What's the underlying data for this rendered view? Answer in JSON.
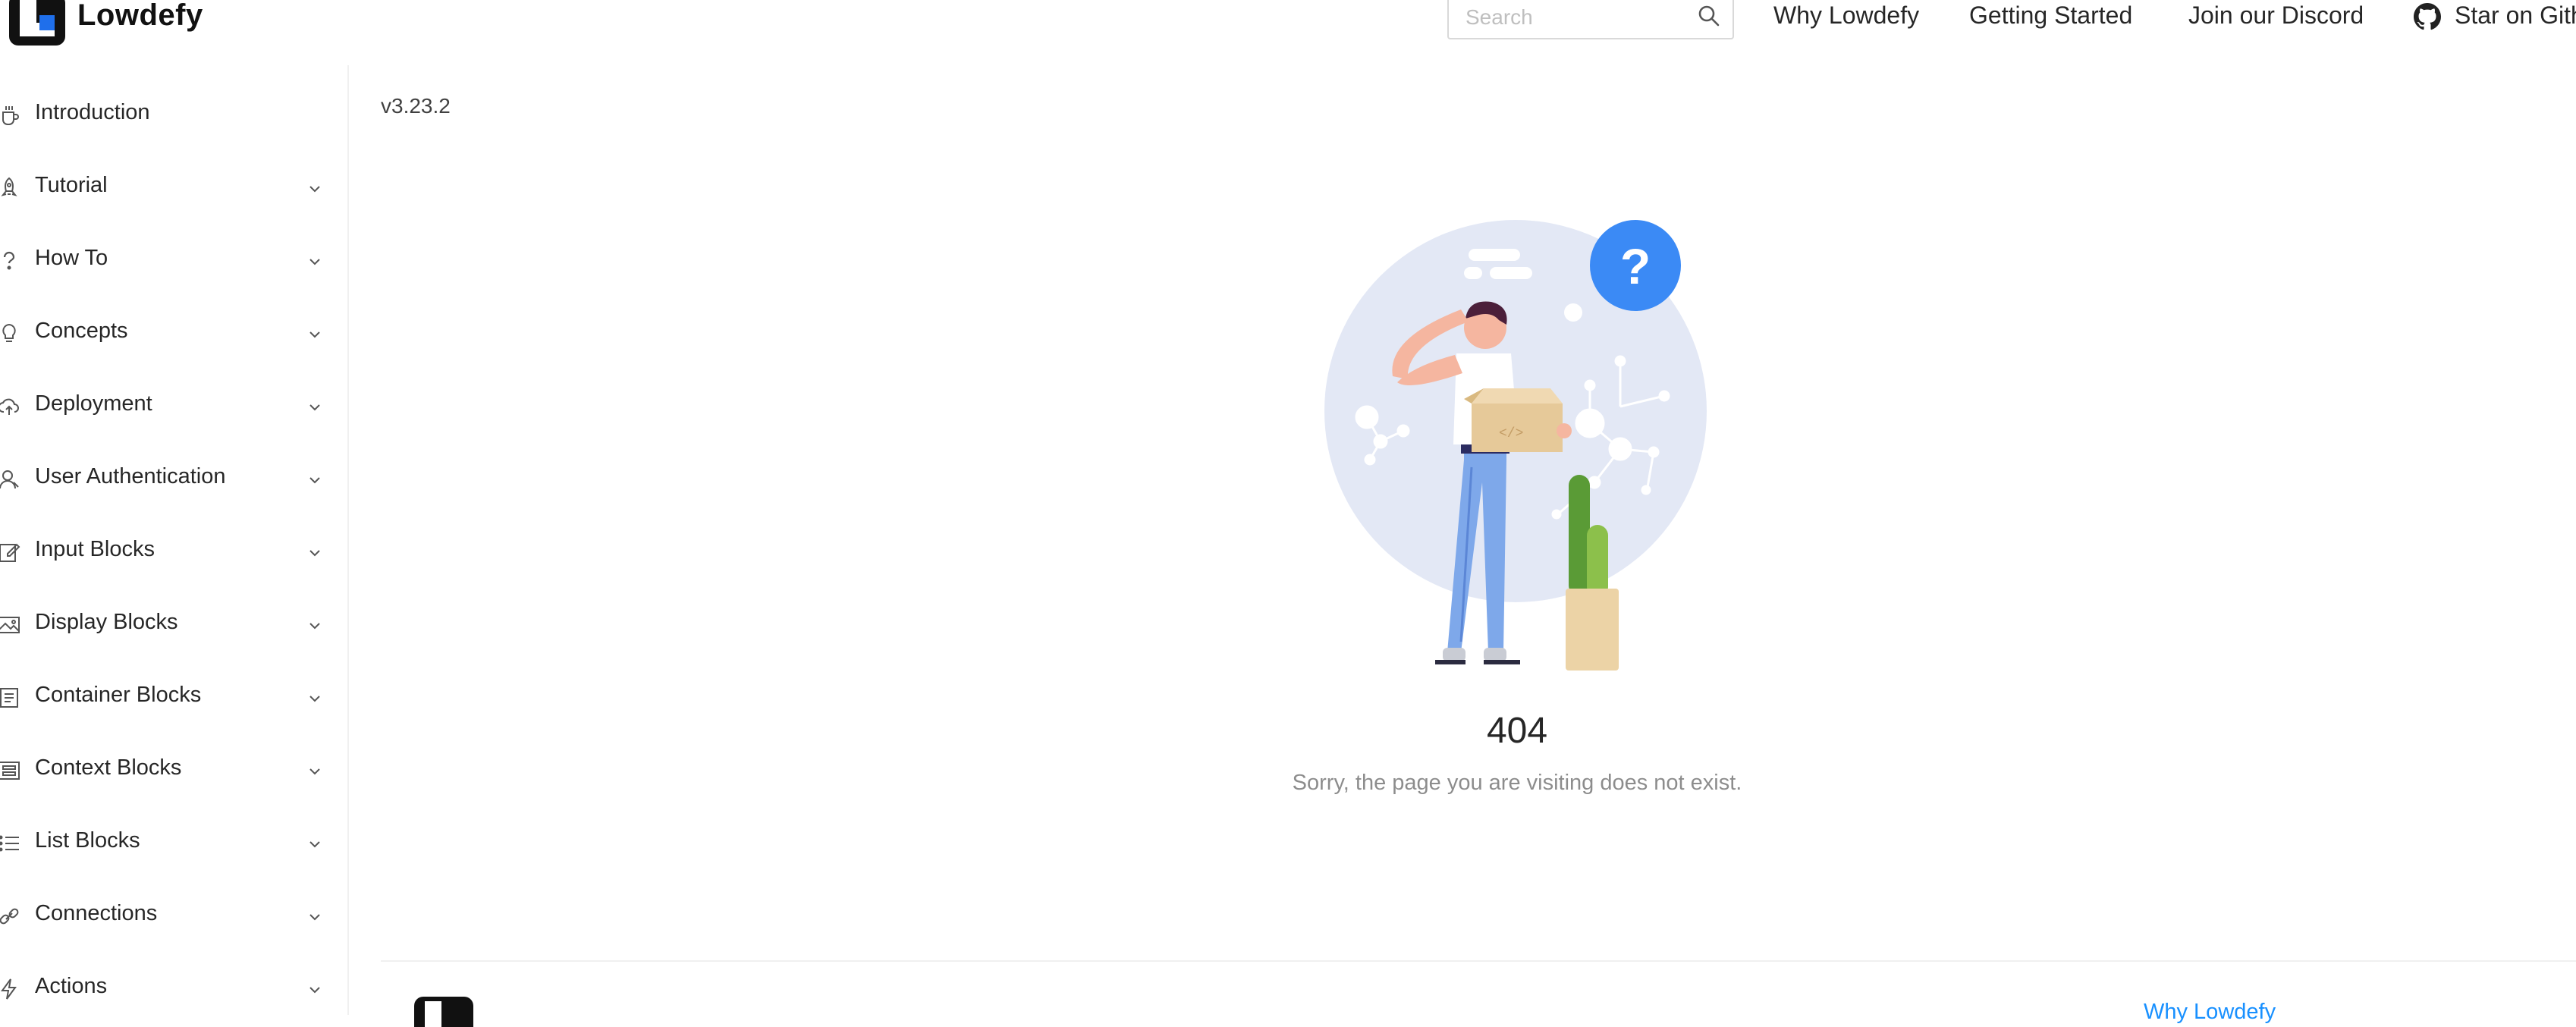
{
  "header": {
    "brand": "Lowdefy",
    "search": {
      "placeholder": "Search"
    },
    "nav": [
      {
        "label": "Why Lowdefy"
      },
      {
        "label": "Getting Started"
      },
      {
        "label": "Join our Discord"
      },
      {
        "label": "Star on Github"
      }
    ]
  },
  "sidebar": {
    "items": [
      {
        "label": "Introduction",
        "icon": "coffee-icon",
        "expandable": false
      },
      {
        "label": "Tutorial",
        "icon": "rocket-icon",
        "expandable": true
      },
      {
        "label": "How To",
        "icon": "question-icon",
        "expandable": true
      },
      {
        "label": "Concepts",
        "icon": "bulb-icon",
        "expandable": true
      },
      {
        "label": "Deployment",
        "icon": "cloud-upload-icon",
        "expandable": true
      },
      {
        "label": "User Authentication",
        "icon": "user-icon",
        "expandable": true
      },
      {
        "label": "Input Blocks",
        "icon": "form-icon",
        "expandable": true
      },
      {
        "label": "Display Blocks",
        "icon": "picture-icon",
        "expandable": true
      },
      {
        "label": "Container Blocks",
        "icon": "container-icon",
        "expandable": true
      },
      {
        "label": "Context Blocks",
        "icon": "context-icon",
        "expandable": true
      },
      {
        "label": "List Blocks",
        "icon": "list-icon",
        "expandable": true
      },
      {
        "label": "Connections",
        "icon": "link-icon",
        "expandable": true
      },
      {
        "label": "Actions",
        "icon": "thunderbolt-icon",
        "expandable": true
      }
    ]
  },
  "main": {
    "version": "v3.23.2",
    "result": {
      "status_code": "404",
      "message": "Sorry, the page you are visiting does not exist."
    }
  },
  "footer": {
    "link": "Why Lowdefy"
  },
  "colors": {
    "accent": "#1890ff",
    "question_bubble": "#3b8af5",
    "illustration_circle": "#e3e8f5"
  }
}
